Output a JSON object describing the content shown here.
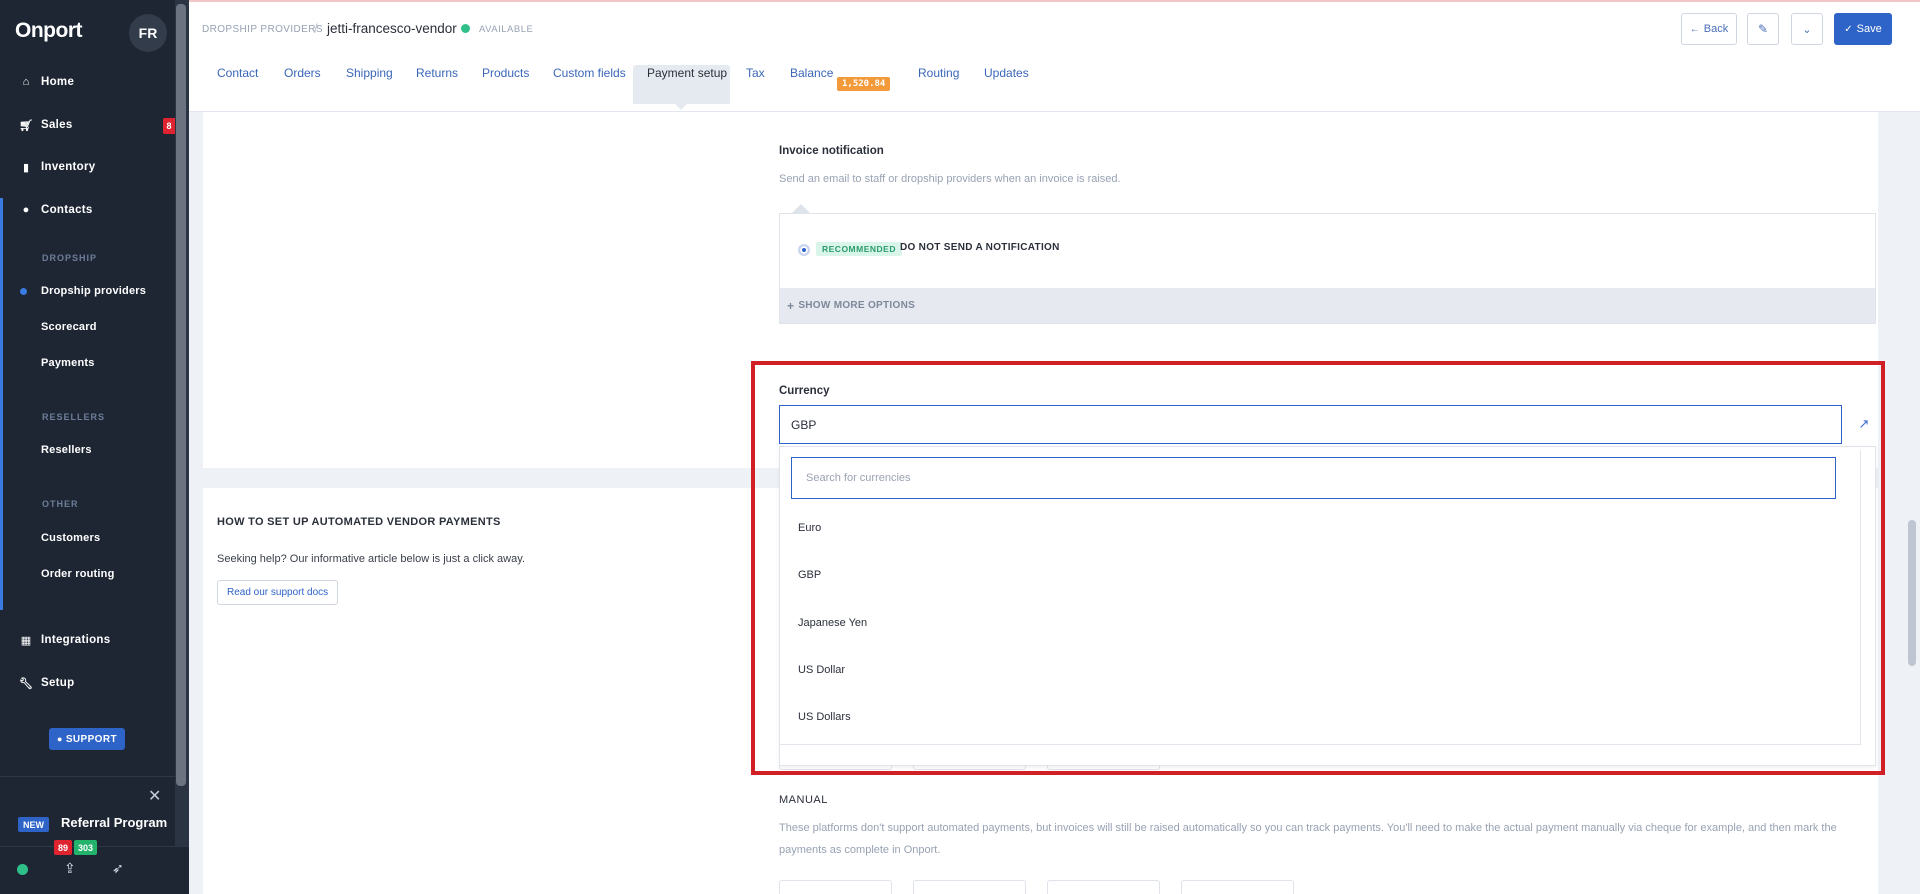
{
  "app": {
    "logo": "Onport",
    "user_initials": "FR"
  },
  "sidebar": {
    "nav": [
      {
        "label": "Home",
        "icon": "home-icon"
      },
      {
        "label": "Sales",
        "icon": "cart-icon",
        "badge": "8"
      },
      {
        "label": "Inventory",
        "icon": "bookmark-icon"
      },
      {
        "label": "Contacts",
        "icon": "user-icon"
      },
      {
        "label": "Integrations",
        "icon": "grid-icon"
      },
      {
        "label": "Setup",
        "icon": "wrench-icon"
      }
    ],
    "sections": {
      "dropship": "DROPSHIP",
      "resellers": "RESELLERS",
      "other": "OTHER"
    },
    "sub_items": {
      "dropship_providers": "Dropship providers",
      "scorecard": "Scorecard",
      "payments": "Payments",
      "resellers": "Resellers",
      "customers": "Customers",
      "order_routing": "Order routing"
    },
    "support_label": "SUPPORT",
    "referral": {
      "new_tag": "NEW",
      "label": "Referral Program"
    },
    "counts": {
      "red": "89",
      "green": "303"
    }
  },
  "header": {
    "breadcrumb_parent": "DROPSHIP PROVIDERS",
    "breadcrumb_sep": "/",
    "vendor_name": "jetti-francesco-vendor",
    "status": "AVAILABLE",
    "back_label": "Back",
    "save_label": "Save"
  },
  "tabs": [
    {
      "label": "Contact"
    },
    {
      "label": "Orders"
    },
    {
      "label": "Shipping"
    },
    {
      "label": "Returns"
    },
    {
      "label": "Products"
    },
    {
      "label": "Custom fields"
    },
    {
      "label": "Payment setup",
      "active": true
    },
    {
      "label": "Tax"
    },
    {
      "label": "Balance",
      "badge": "1,520.84"
    },
    {
      "label": "Routing"
    },
    {
      "label": "Updates"
    }
  ],
  "invoice_notification": {
    "title": "Invoice notification",
    "help": "Send an email to staff or dropship providers when an invoice is raised.",
    "recommended_tag": "RECOMMENDED",
    "selected_option": "DO NOT SEND A NOTIFICATION",
    "more_options": "SHOW MORE OPTIONS"
  },
  "currency": {
    "label": "Currency",
    "value": "GBP",
    "search_placeholder": "Search for currencies",
    "options": [
      "Euro",
      "GBP",
      "Japanese Yen",
      "US Dollar",
      "US Dollars"
    ]
  },
  "howto": {
    "title": "HOW TO SET UP AUTOMATED VENDOR PAYMENTS",
    "text": "Seeking help? Our informative article below is just a click away.",
    "link_label": "Read our support docs"
  },
  "manual": {
    "title": "MANUAL",
    "text": "These platforms don't support automated payments, but invoices will still be raised automatically so you can track payments. You'll need to make the actual payment manually via cheque for example, and then mark the payments as complete in Onport."
  }
}
